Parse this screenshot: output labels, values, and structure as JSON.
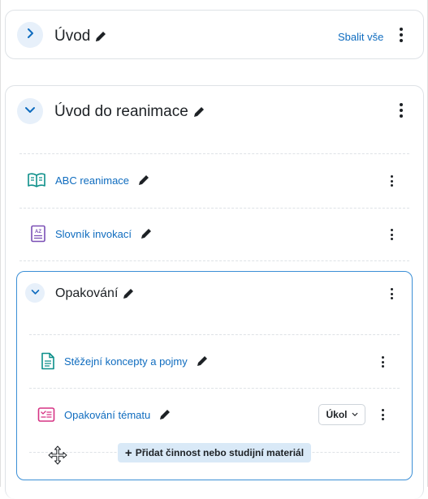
{
  "section1": {
    "title": "Úvod",
    "collapse_all_label": "Sbalit vše",
    "toggle_icon": "chevron-right-icon"
  },
  "section2": {
    "title": "Úvod do reanimace",
    "toggle_icon": "chevron-down-icon",
    "activities": [
      {
        "name": "ABC reanimace",
        "icon": "book-icon",
        "icon_color": "#0d8f8a"
      },
      {
        "name": "Slovník invokací",
        "icon": "glossary-icon",
        "icon_color": "#7a4fb5"
      }
    ],
    "subsection": {
      "title": "Opakování",
      "activities": [
        {
          "name": "Stěžejní koncepty a pojmy",
          "icon": "page-icon",
          "icon_color": "#0d8f8a"
        },
        {
          "name": "Opakování tématu",
          "icon": "lesson-icon",
          "icon_color": "#d63384",
          "badge": "Úkol"
        }
      ],
      "add_button": {
        "plus": "+",
        "label": "Přidat činnost nebo studijní materiál"
      }
    }
  },
  "colors": {
    "link": "#0f6cbf",
    "accent": "#3b8fd6",
    "toggle_bg": "#e7f0fa",
    "add_bg": "#d9e9f7"
  }
}
